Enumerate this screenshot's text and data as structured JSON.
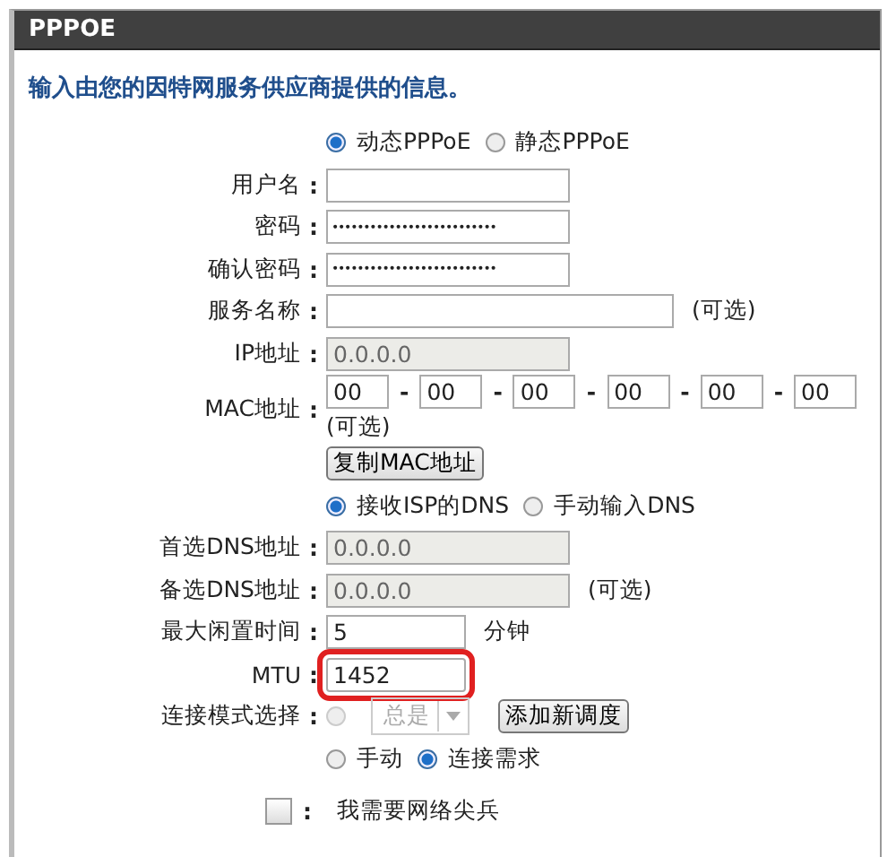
{
  "header": {
    "title": "PPPOE"
  },
  "intro": "输入由您的因特网服务供应商提供的信息。",
  "rows": [
    {
      "kind": "radio",
      "options": [
        {
          "label": "动态PPPoE",
          "selected": true
        },
        {
          "label": "静态PPPoE",
          "selected": false
        }
      ]
    },
    {
      "kind": "input",
      "label": "用户名",
      "colon": ":"
    },
    {
      "kind": "password",
      "label": "密码",
      "colon": ":",
      "value": "••••••••••••••••••••••••••"
    },
    {
      "kind": "password",
      "label": "确认密码",
      "colon": ":",
      "value": "••••••••••••••••••••••••••"
    },
    {
      "kind": "wide-input",
      "label": "服务名称",
      "colon": ":",
      "note": "(可选)"
    },
    {
      "kind": "input",
      "label": "IP地址",
      "colon": ":",
      "value": "0.0.0.0",
      "disabled": true
    },
    {
      "kind": "mac",
      "label": "MAC地址",
      "colon": ":",
      "parts": [
        "00",
        "00",
        "00",
        "00",
        "00",
        "00"
      ],
      "dashes": [
        "-",
        "-",
        "-",
        "-",
        "-"
      ],
      "note": "(可选)"
    },
    {
      "kind": "button",
      "label": "复制MAC地址"
    },
    {
      "kind": "radio",
      "options": [
        {
          "label": "接收ISP的DNS",
          "selected": true
        },
        {
          "label": "手动输入DNS",
          "selected": false
        }
      ]
    },
    {
      "kind": "input",
      "label": "首选DNS地址",
      "colon": ":",
      "value": "0.0.0.0",
      "disabled": true
    },
    {
      "kind": "input",
      "label": "备选DNS地址",
      "colon": ":",
      "value": "0.0.0.0",
      "disabled": true,
      "note": "(可选)"
    },
    {
      "kind": "short-input",
      "label": "最大闲置时间",
      "colon": ":",
      "value": "5",
      "note": "分钟"
    },
    {
      "kind": "short-input",
      "label": "MTU",
      "colon": ":",
      "value": "1452",
      "highlighted": true
    },
    {
      "kind": "schedule",
      "label": "连接模式选择",
      "colon": ":",
      "selected": false,
      "select": "总是",
      "button": "添加新调度"
    },
    {
      "kind": "radio",
      "options": [
        {
          "label": "手动",
          "selected": false
        },
        {
          "label": "连接需求",
          "selected": true
        }
      ]
    },
    {
      "kind": "checkbox",
      "label": "我需要网络尖兵",
      "colon": ":",
      "checked": false
    }
  ]
}
